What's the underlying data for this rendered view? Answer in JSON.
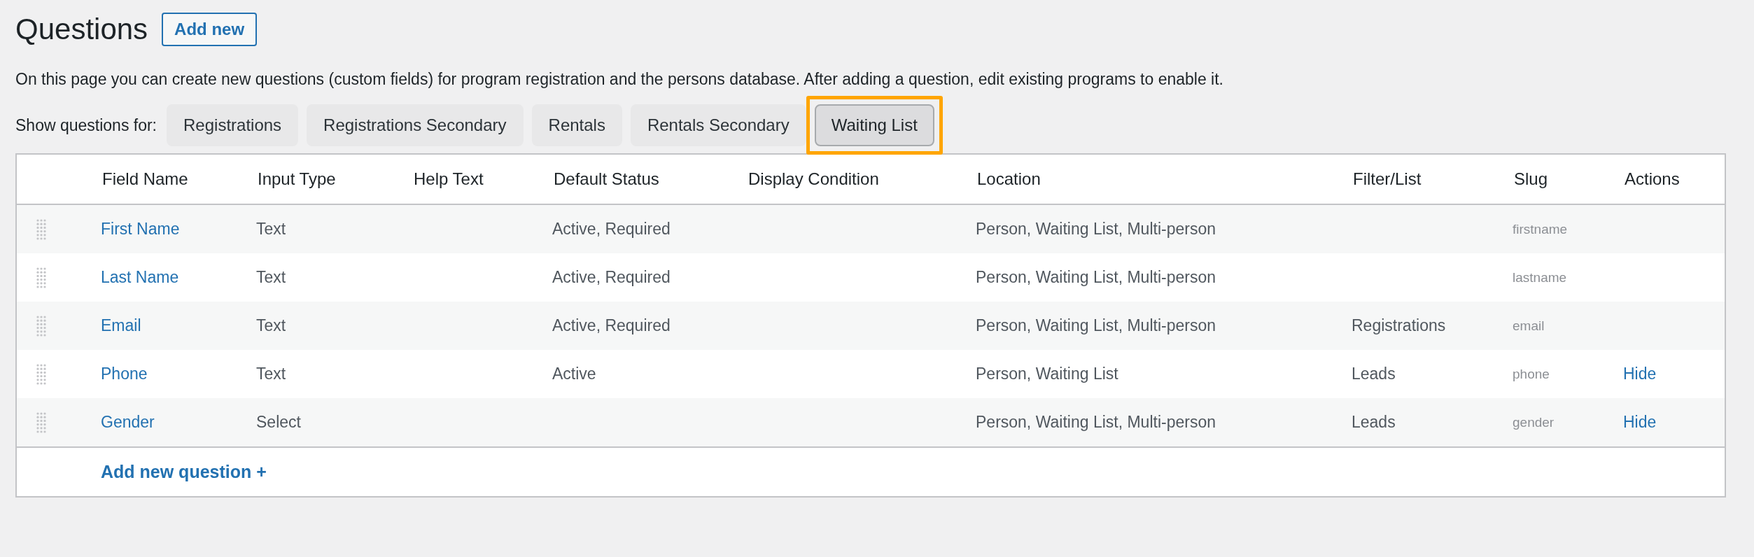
{
  "page": {
    "title": "Questions",
    "add_button": "Add new",
    "description": "On this page you can create new questions (custom fields) for program registration and the persons database. After adding a question, edit existing programs to enable it."
  },
  "filter": {
    "label": "Show questions for:",
    "tabs": [
      {
        "label": "Registrations",
        "selected": false
      },
      {
        "label": "Registrations Secondary",
        "selected": false
      },
      {
        "label": "Rentals",
        "selected": false
      },
      {
        "label": "Rentals Secondary",
        "selected": false
      },
      {
        "label": "Waiting List",
        "selected": true
      }
    ]
  },
  "table": {
    "columns": [
      "Field Name",
      "Input Type",
      "Help Text",
      "Default Status",
      "Display Condition",
      "Location",
      "Filter/List",
      "Slug",
      "Actions"
    ],
    "rows": [
      {
        "field_name": "First Name",
        "input_type": "Text",
        "help_text": "",
        "default_status": "Active, Required",
        "display_condition": "",
        "location": "Person, Waiting List, Multi-person",
        "filter_list": "",
        "slug": "firstname",
        "action": ""
      },
      {
        "field_name": "Last Name",
        "input_type": "Text",
        "help_text": "",
        "default_status": "Active, Required",
        "display_condition": "",
        "location": "Person, Waiting List, Multi-person",
        "filter_list": "",
        "slug": "lastname",
        "action": ""
      },
      {
        "field_name": "Email",
        "input_type": "Text",
        "help_text": "",
        "default_status": "Active, Required",
        "display_condition": "",
        "location": "Person, Waiting List, Multi-person",
        "filter_list": "Registrations",
        "slug": "email",
        "action": ""
      },
      {
        "field_name": "Phone",
        "input_type": "Text",
        "help_text": "",
        "default_status": "Active",
        "display_condition": "",
        "location": "Person, Waiting List",
        "filter_list": "Leads",
        "slug": "phone",
        "action": "Hide"
      },
      {
        "field_name": "Gender",
        "input_type": "Select",
        "help_text": "",
        "default_status": "",
        "display_condition": "",
        "location": "Person, Waiting List, Multi-person",
        "filter_list": "Leads",
        "slug": "gender",
        "action": "Hide"
      }
    ],
    "add_link": "Add new question +"
  }
}
